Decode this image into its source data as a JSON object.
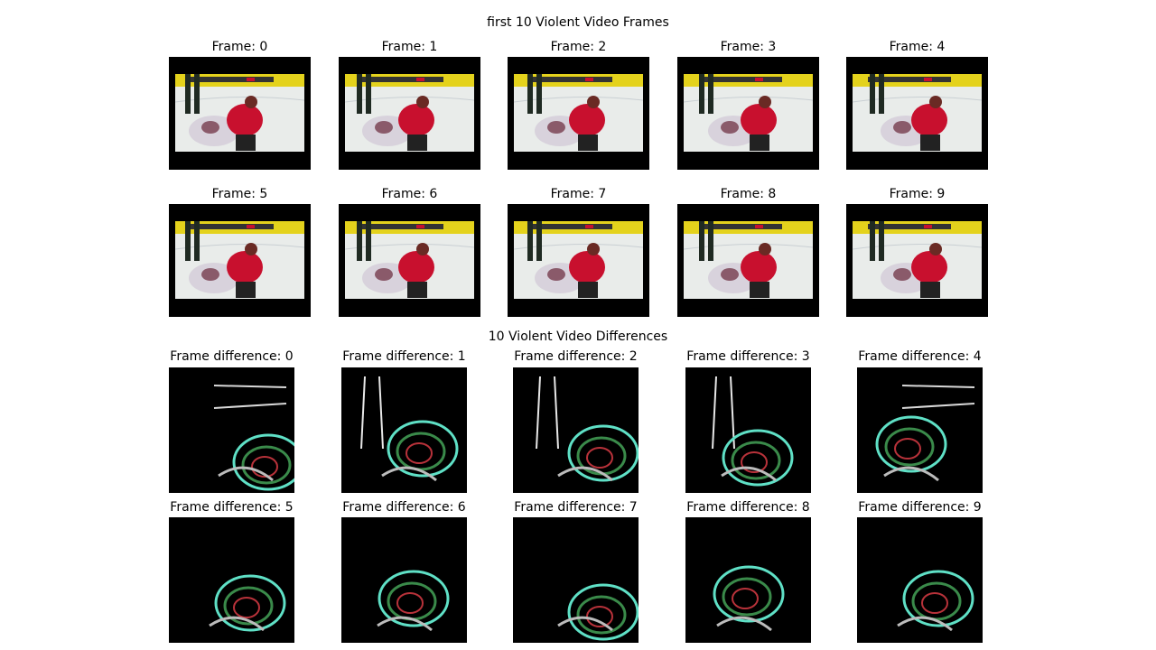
{
  "frames_section": {
    "title": "first 10 Violent Video Frames",
    "captions": [
      "Frame: 0",
      "Frame: 1",
      "Frame: 2",
      "Frame: 3",
      "Frame: 4",
      "Frame: 5",
      "Frame: 6",
      "Frame: 7",
      "Frame: 8",
      "Frame: 9"
    ]
  },
  "diffs_section": {
    "title": "10 Violent Video Differences",
    "captions": [
      "Frame difference: 0",
      "Frame difference: 1",
      "Frame difference: 2",
      "Frame difference: 3",
      "Frame difference: 4",
      "Frame difference: 5",
      "Frame difference: 6",
      "Frame difference: 7",
      "Frame difference: 8",
      "Frame difference: 9"
    ]
  },
  "colors": {
    "rink": "#e9ecea",
    "board": "#e4d21c",
    "jersey_red": "#c8102e",
    "jersey_white": "#d8d2dc",
    "edge_cyan": "#5fe0c6",
    "edge_green": "#3a8a4a",
    "edge_red": "#b8323a"
  }
}
